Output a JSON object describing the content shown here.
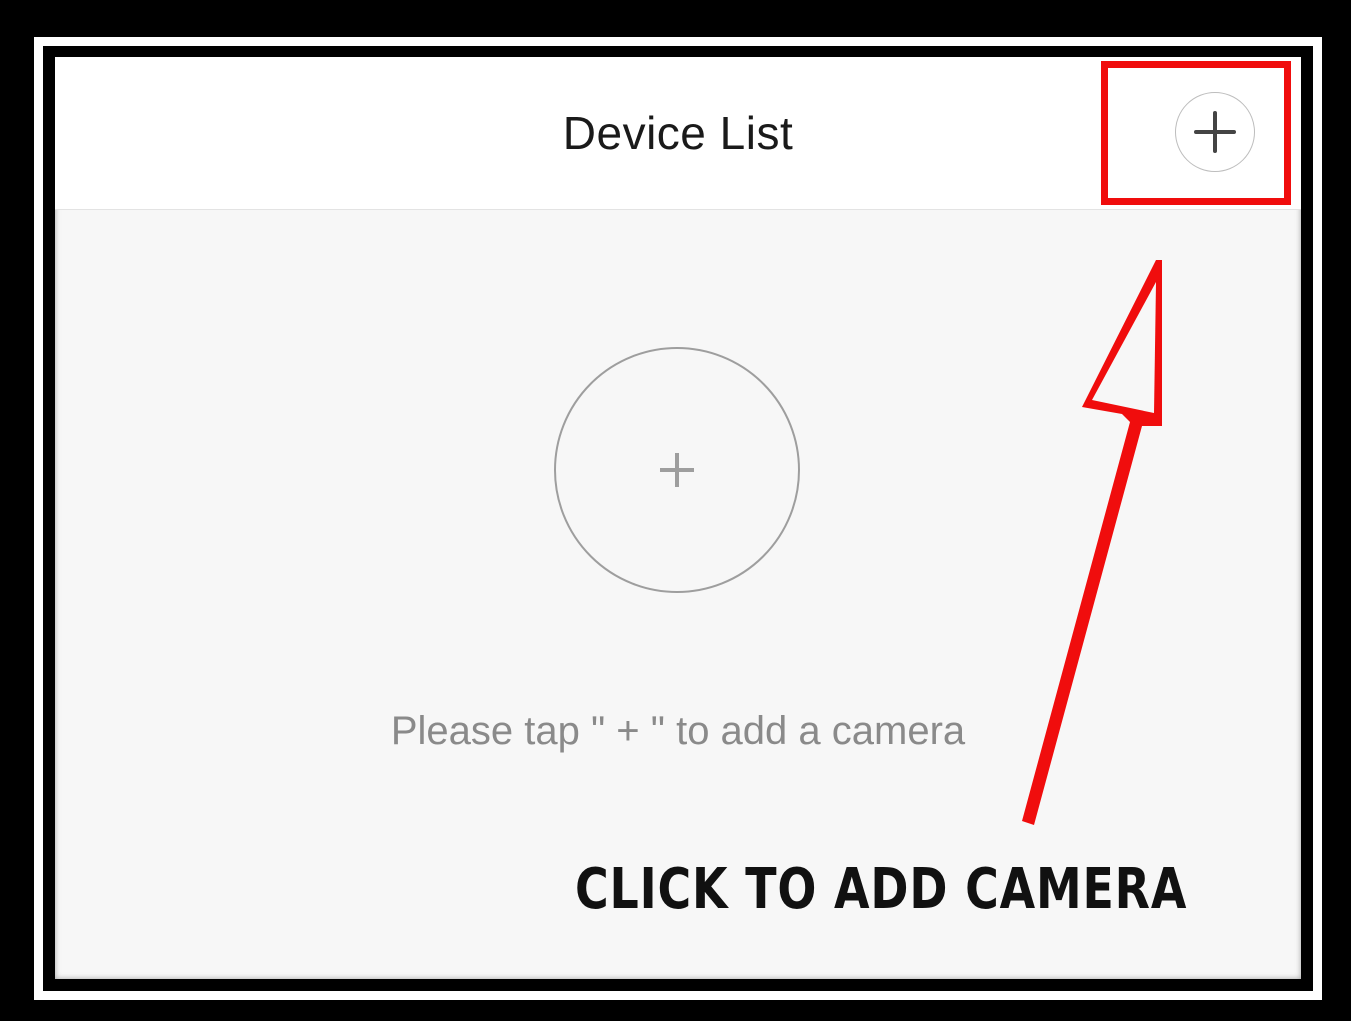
{
  "header": {
    "title": "Device List",
    "add_icon": "plus-circle-icon"
  },
  "empty_state": {
    "add_icon": "plus-icon",
    "hint": "Please tap \" + \" to add a camera"
  },
  "annotation": {
    "label": "CLICK TO ADD CAMERA",
    "arrow_icon": "arrow-up-icon",
    "color": "#f00d0d"
  },
  "colors": {
    "frame": "#000000",
    "background": "#f7f7f7",
    "header_bg": "#ffffff",
    "highlight": "#f00d0d"
  }
}
